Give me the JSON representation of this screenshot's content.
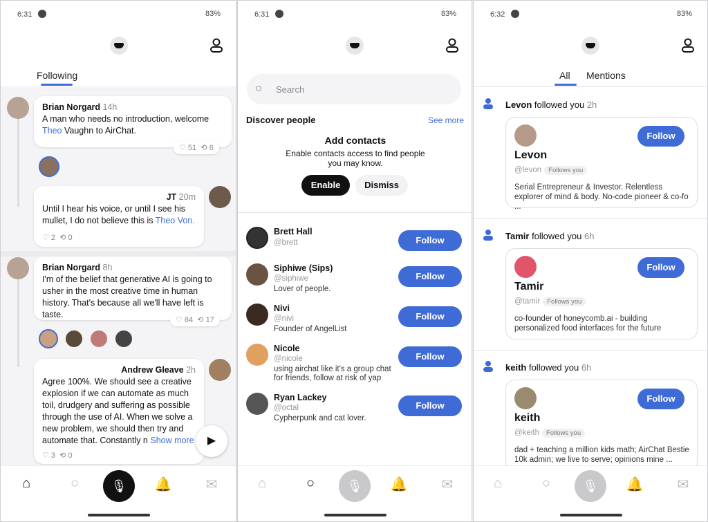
{
  "screens": [
    {
      "time": "6:31",
      "battery": "83%"
    },
    {
      "time": "6:31",
      "battery": "83%"
    },
    {
      "time": "6:32",
      "battery": "83%"
    }
  ],
  "feed": {
    "tab": "Following",
    "posts": [
      {
        "author": "Brian Norgard",
        "time": "14h",
        "text_pre": "A man who needs no introduction, welcome ",
        "link": "Theo",
        "text_post": " Vaughn to AirChat.",
        "likes": "51",
        "reposts": "6"
      },
      {
        "author": "JT",
        "time": "20m",
        "text_pre": "Until I hear his voice, or until I see his mullet, I do not believe this is ",
        "link": "Theo Von.",
        "likes": "2",
        "reposts": "0"
      },
      {
        "author": "Brian Norgard",
        "time": "8h",
        "text": "I'm of the belief that generative AI is going to usher in the most creative time in human history. That's because all we'll have left is taste.",
        "likes": "84",
        "reposts": "17"
      },
      {
        "author": "Andrew Gleave",
        "time": "2h",
        "text": "Agree 100%. We should see a creative explosion if we can automate as much toil, drudgery and suffering as possible through the use of AI. When we solve a new problem, we should then try and automate that. Constantly n",
        "show_more": "Show more",
        "likes": "3",
        "reposts": "0"
      }
    ]
  },
  "search": {
    "placeholder": "Search",
    "discover": "Discover people",
    "see_more": "See more",
    "contacts_title": "Add contacts",
    "contacts_text": "Enable contacts access to find people you may know.",
    "enable": "Enable",
    "dismiss": "Dismiss",
    "people": [
      {
        "name": "Brett Hall",
        "handle": "@brett",
        "bio": ""
      },
      {
        "name": "Siphiwe (Sips)",
        "handle": "@siphiwe",
        "bio": "Lover of people."
      },
      {
        "name": "Nivi",
        "handle": "@nivi",
        "bio": "Founder of AngelList"
      },
      {
        "name": "Nicole",
        "handle": "@nicole",
        "bio": "using airchat like it's a group chat for friends, follow at risk of yap"
      },
      {
        "name": "Ryan Lackey",
        "handle": "@octal",
        "bio": "Cypherpunk and cat lover."
      }
    ],
    "follow_label": "Follow"
  },
  "notifications": {
    "tabs": [
      "All",
      "Mentions"
    ],
    "items": [
      {
        "name": "Levon",
        "action": "followed you",
        "time": "2h",
        "handle": "@levon",
        "badge": "Follows you",
        "bio": "Serial Entrepreneur & Investor. Relentless explorer of mind & body. No-code pioneer & co-fo  ..."
      },
      {
        "name": "Tamir",
        "action": "followed you",
        "time": "6h",
        "handle": "@tamir",
        "badge": "Follows you",
        "bio": "co-founder of honeycomb.ai - building personalized food interfaces for the future"
      },
      {
        "name": "keith",
        "action": "followed you",
        "time": "6h",
        "handle": "@keith",
        "badge": "Follows you",
        "bio": "dad + teaching a million kids math; AirChat Bestie 10k admin; we live to serve; opinions mine  ..."
      }
    ],
    "follow_label": "Follow"
  },
  "colors": {
    "accent": "#3f6bd6",
    "feed_bg": "#f4f4f6"
  }
}
